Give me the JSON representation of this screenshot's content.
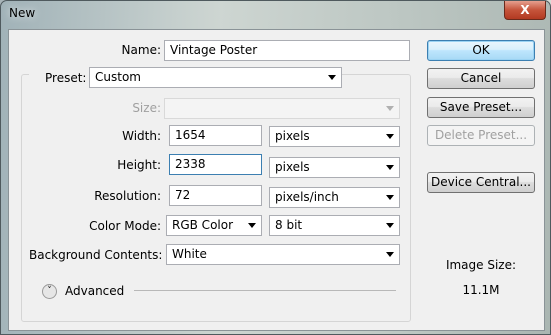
{
  "window": {
    "title": "New",
    "close_glyph": "X"
  },
  "form": {
    "name_label": "Name:",
    "name_value": "Vintage Poster",
    "preset_label": "Preset:",
    "preset_value": "Custom",
    "size_label": "Size:",
    "size_value": "",
    "width_label": "Width:",
    "width_value": "1654",
    "width_unit": "pixels",
    "height_label": "Height:",
    "height_value": "2338",
    "height_unit": "pixels",
    "resolution_label": "Resolution:",
    "resolution_value": "72",
    "resolution_unit": "pixels/inch",
    "color_mode_label": "Color Mode:",
    "color_mode_value": "RGB Color",
    "bit_depth_value": "8 bit",
    "background_label": "Background Contents:",
    "background_value": "White",
    "advanced_label": "Advanced"
  },
  "buttons": {
    "ok": "OK",
    "cancel": "Cancel",
    "save_preset": "Save Preset...",
    "delete_preset": "Delete Preset...",
    "device_central": "Device Central..."
  },
  "info": {
    "image_size_label": "Image Size:",
    "image_size_value": "11.1M"
  },
  "colors": {
    "accent": "#3c7fb1",
    "close_button": "#c5543b",
    "dialog_bg": "#f0f0f0"
  },
  "icons": {
    "close": "close-icon",
    "dropdown": "chevron-down-icon",
    "advanced": "double-chevron-down-icon"
  }
}
